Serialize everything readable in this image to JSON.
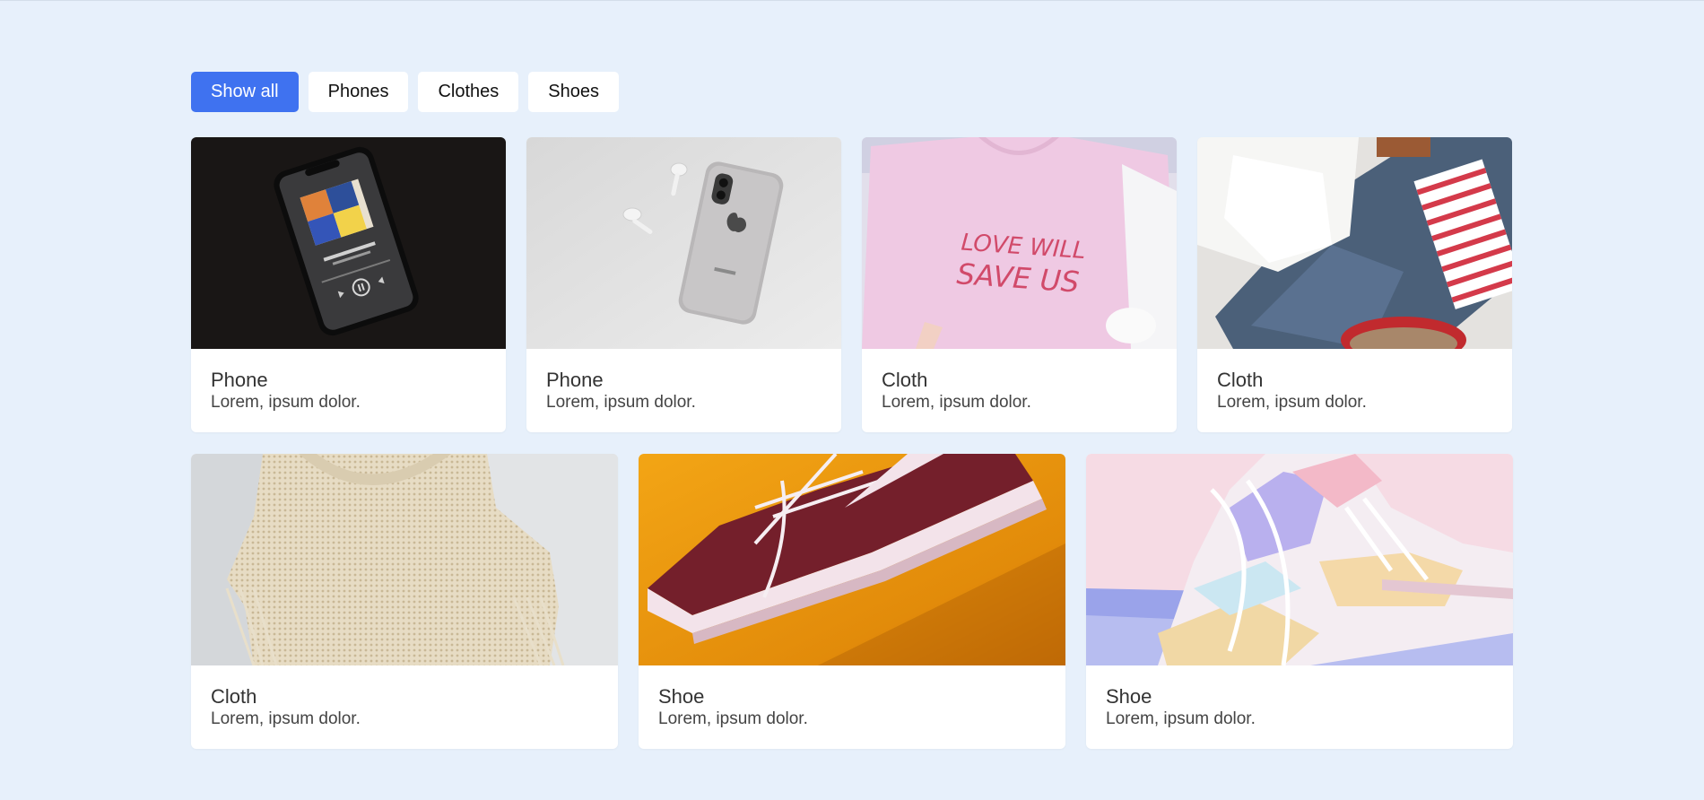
{
  "filters": [
    {
      "label": "Show all",
      "active": true
    },
    {
      "label": "Phones",
      "active": false
    },
    {
      "label": "Clothes",
      "active": false
    },
    {
      "label": "Shoes",
      "active": false
    }
  ],
  "cards": [
    {
      "title": "Phone",
      "desc": "Lorem, ipsum dolor.",
      "image": "phone-music-player-image"
    },
    {
      "title": "Phone",
      "desc": "Lorem, ipsum dolor.",
      "image": "phone-airpods-image"
    },
    {
      "title": "Cloth",
      "desc": "Lorem, ipsum dolor.",
      "image": "pink-tshirt-image"
    },
    {
      "title": "Cloth",
      "desc": "Lorem, ipsum dolor.",
      "image": "clothes-jeans-image"
    },
    {
      "title": "Cloth",
      "desc": "Lorem, ipsum dolor.",
      "image": "knit-top-image"
    },
    {
      "title": "Shoe",
      "desc": "Lorem, ipsum dolor.",
      "image": "red-sneaker-image"
    },
    {
      "title": "Shoe",
      "desc": "Lorem, ipsum dolor.",
      "image": "pastel-sneaker-image"
    }
  ],
  "tshirt_text": {
    "line1": "LOVE WILL",
    "line2": "SAVE US"
  },
  "colors": {
    "accent": "#3f72f0",
    "background": "#e7f0fb",
    "card": "#ffffff"
  }
}
